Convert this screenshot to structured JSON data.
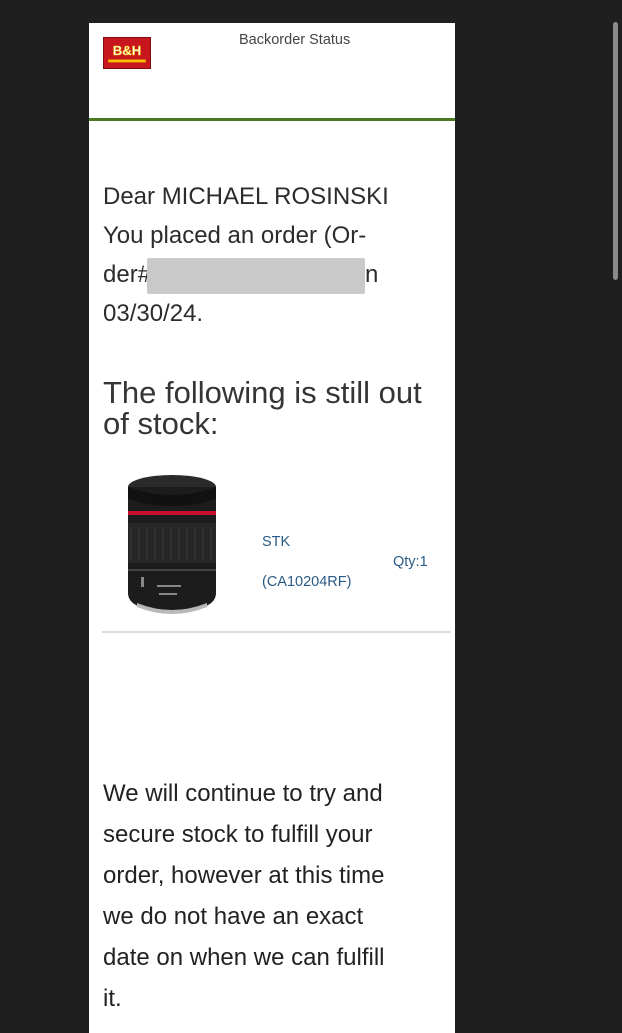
{
  "header": {
    "logo_text": "B&H",
    "title": "Backorder Status"
  },
  "greeting": {
    "line1": "Dear MICHAEL ROSINSKI",
    "line2": "You placed an order (Or-",
    "line3_prefix": "der#",
    "line3_suffix": "n",
    "line4": "03/30/24."
  },
  "out_of_stock": {
    "heading": "The following is still out of stock:"
  },
  "product": {
    "sku": "STK",
    "model": "(CA10204RF)",
    "qty": "Qty:1"
  },
  "message": {
    "lines": [
      "We will continue to try and",
      "secure stock to fulfill your",
      "order, however at this time",
      "we do not have an exact",
      "date on when we can fulfill",
      "it."
    ]
  },
  "colors": {
    "accent_rule": "#4a7a1f",
    "link_blue": "#2a5b86",
    "logo_red": "#c7161d"
  }
}
